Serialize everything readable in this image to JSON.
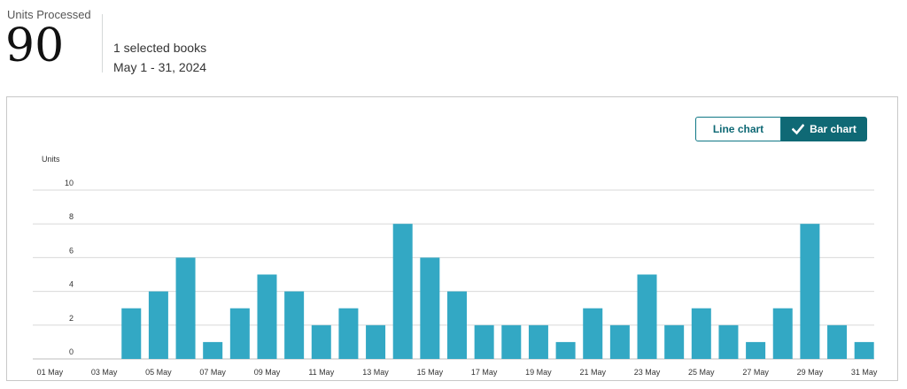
{
  "summary": {
    "metric_label": "Units Processed",
    "metric_value": "90",
    "selection": "1 selected books",
    "date_range": "May 1 - 31, 2024"
  },
  "toggle": {
    "line_label": "Line chart",
    "bar_label": "Bar chart",
    "active": "bar",
    "active_icon": "check-icon"
  },
  "colors": {
    "bar": "#33a8c4",
    "accent": "#0f6975",
    "grid": "#d9d9d9"
  },
  "chart_data": {
    "type": "bar",
    "title": "",
    "xlabel": "",
    "ylabel": "Units",
    "ylim": [
      0,
      10
    ],
    "yticks": [
      0,
      2,
      4,
      6,
      8,
      10
    ],
    "grid": true,
    "categories": [
      "01 May",
      "02 May",
      "03 May",
      "04 May",
      "05 May",
      "06 May",
      "07 May",
      "08 May",
      "09 May",
      "10 May",
      "11 May",
      "12 May",
      "13 May",
      "14 May",
      "15 May",
      "16 May",
      "17 May",
      "18 May",
      "19 May",
      "20 May",
      "21 May",
      "22 May",
      "23 May",
      "24 May",
      "25 May",
      "26 May",
      "27 May",
      "28 May",
      "29 May",
      "30 May",
      "31 May"
    ],
    "x_tick_labels": [
      "01 May",
      "03 May",
      "05 May",
      "07 May",
      "09 May",
      "11 May",
      "13 May",
      "15 May",
      "17 May",
      "19 May",
      "21 May",
      "23 May",
      "25 May",
      "27 May",
      "29 May",
      "31 May"
    ],
    "values": [
      0,
      0,
      0,
      3,
      4,
      6,
      1,
      3,
      5,
      4,
      2,
      3,
      2,
      8,
      6,
      4,
      2,
      2,
      2,
      1,
      3,
      2,
      5,
      2,
      3,
      2,
      1,
      3,
      8,
      2,
      1
    ]
  }
}
